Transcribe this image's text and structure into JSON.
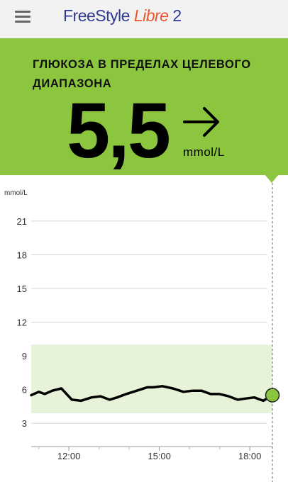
{
  "app": {
    "logo_part1": "FreeStyle ",
    "logo_part2": "Libre",
    "logo_part3": " 2",
    "menu_icon": "hamburger-menu-icon"
  },
  "glucose": {
    "status": "ГЛЮКОЗА В ПРЕДЕЛАХ ЦЕЛЕВОГО ДИАПАЗОНА",
    "value": "5,5",
    "unit": "mmol/L",
    "trend_icon": "arrow-right-icon",
    "status_color": "#8cc63f"
  },
  "chart_data": {
    "type": "line",
    "title": "",
    "xlabel": "",
    "ylabel": "mmol/L",
    "ylim": [
      0,
      22
    ],
    "y_ticks": [
      3,
      6,
      9,
      12,
      15,
      18,
      21
    ],
    "x_tick_labels": [
      "12:00",
      "15:00",
      "18:00"
    ],
    "x_tick_hours": [
      12,
      15,
      18
    ],
    "xlim_hours": [
      10.75,
      18.75
    ],
    "target_range": [
      3.9,
      10.0
    ],
    "target_color": "#e6f3d8",
    "line_color": "#000000",
    "current_point": {
      "hour": 18.75,
      "value": 5.5,
      "color": "#8cc63f"
    },
    "series": [
      {
        "x": [
          10.75,
          11.0,
          11.2,
          11.45,
          11.75,
          12.1,
          12.4,
          12.75,
          13.05,
          13.35,
          13.6,
          13.9,
          14.25,
          14.6,
          14.8,
          15.1,
          15.45,
          15.8,
          16.1,
          16.4,
          16.7,
          17.0,
          17.3,
          17.6,
          17.85,
          18.15,
          18.45,
          18.75
        ],
        "values": [
          5.5,
          5.8,
          5.6,
          5.9,
          6.1,
          5.1,
          5.0,
          5.3,
          5.4,
          5.1,
          5.3,
          5.6,
          5.9,
          6.2,
          6.2,
          6.3,
          6.1,
          5.8,
          5.9,
          5.9,
          5.6,
          5.6,
          5.4,
          5.1,
          5.2,
          5.3,
          5.0,
          5.5
        ]
      }
    ]
  }
}
